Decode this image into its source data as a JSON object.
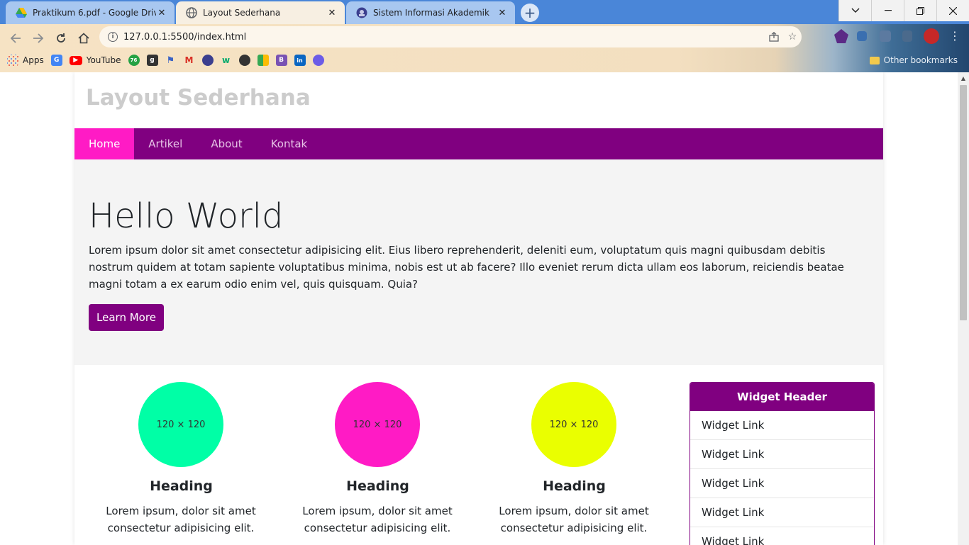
{
  "browser": {
    "tabs": [
      {
        "title": "Praktikum 6.pdf - Google Drive",
        "state": "inactive",
        "icon": "google-drive-icon"
      },
      {
        "title": "Layout Sederhana",
        "state": "active",
        "icon": "globe-icon"
      },
      {
        "title": "Sistem Informasi Akademik",
        "state": "inactive",
        "icon": "university-icon"
      }
    ],
    "new_tab": "+",
    "url": "127.0.0.1:5500/index.html",
    "bookmarks": {
      "apps": "Apps",
      "youtube": "YouTube",
      "whatsapp_badge": "76",
      "goodreads": "g",
      "w3": "w",
      "bootstrap": "B",
      "linkedin": "in",
      "other": "Other bookmarks"
    },
    "colors": {
      "tabbar": "#4a86d8",
      "active_tab": "#f7efe2"
    }
  },
  "site": {
    "title": "Layout Sederhana",
    "nav": [
      {
        "label": "Home",
        "active": true
      },
      {
        "label": "Artikel",
        "active": false
      },
      {
        "label": "About",
        "active": false
      },
      {
        "label": "Kontak",
        "active": false
      }
    ],
    "hero": {
      "heading": "Hello World",
      "text": "Lorem ipsum dolor sit amet consectetur adipisicing elit. Eius libero reprehenderit, deleniti eum, voluptatum quis magni quibusdam debitis nostrum quidem at totam sapiente voluptatibus minima, nobis est ut ab facere? Illo eveniet rerum dicta ullam eos laborum, reiciendis beatae magni totam a ex earum odio enim vel, quis quisquam. Quia?",
      "button": "Learn More"
    },
    "features": [
      {
        "placeholder": "120 × 120",
        "color": "#00ffa6",
        "heading": "Heading",
        "text": "Lorem ipsum, dolor sit amet consectetur adipisicing elit."
      },
      {
        "placeholder": "120 × 120",
        "color": "#ff1bc5",
        "heading": "Heading",
        "text": "Lorem ipsum, dolor sit amet consectetur adipisicing elit."
      },
      {
        "placeholder": "120 × 120",
        "color": "#eaff00",
        "heading": "Heading",
        "text": "Lorem ipsum, dolor sit amet consectetur adipisicing elit."
      }
    ],
    "widget": {
      "header": "Widget Header",
      "links": [
        "Widget Link",
        "Widget Link",
        "Widget Link",
        "Widget Link",
        "Widget Link"
      ]
    },
    "colors": {
      "primary": "#800080",
      "accent": "#ff1bc5"
    }
  }
}
